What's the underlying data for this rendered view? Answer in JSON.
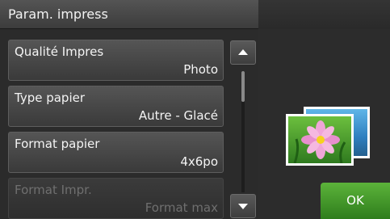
{
  "header": {
    "title": "Param. impress"
  },
  "menu": {
    "items": [
      {
        "label": "Qualité Impres",
        "value": "Photo"
      },
      {
        "label": "Type papier",
        "value": "Autre - Glacé"
      },
      {
        "label": "Format papier",
        "value": "4x6po"
      },
      {
        "label": "Format Impr.",
        "value": "Format max"
      }
    ]
  },
  "scroll": {
    "up_icon": "arrow-up",
    "down_icon": "arrow-down"
  },
  "preview": {
    "icon": "flower-photo-icon"
  },
  "actions": {
    "ok_label": "OK"
  },
  "colors": {
    "accent_green": "#3c8f24",
    "background": "#262626"
  }
}
